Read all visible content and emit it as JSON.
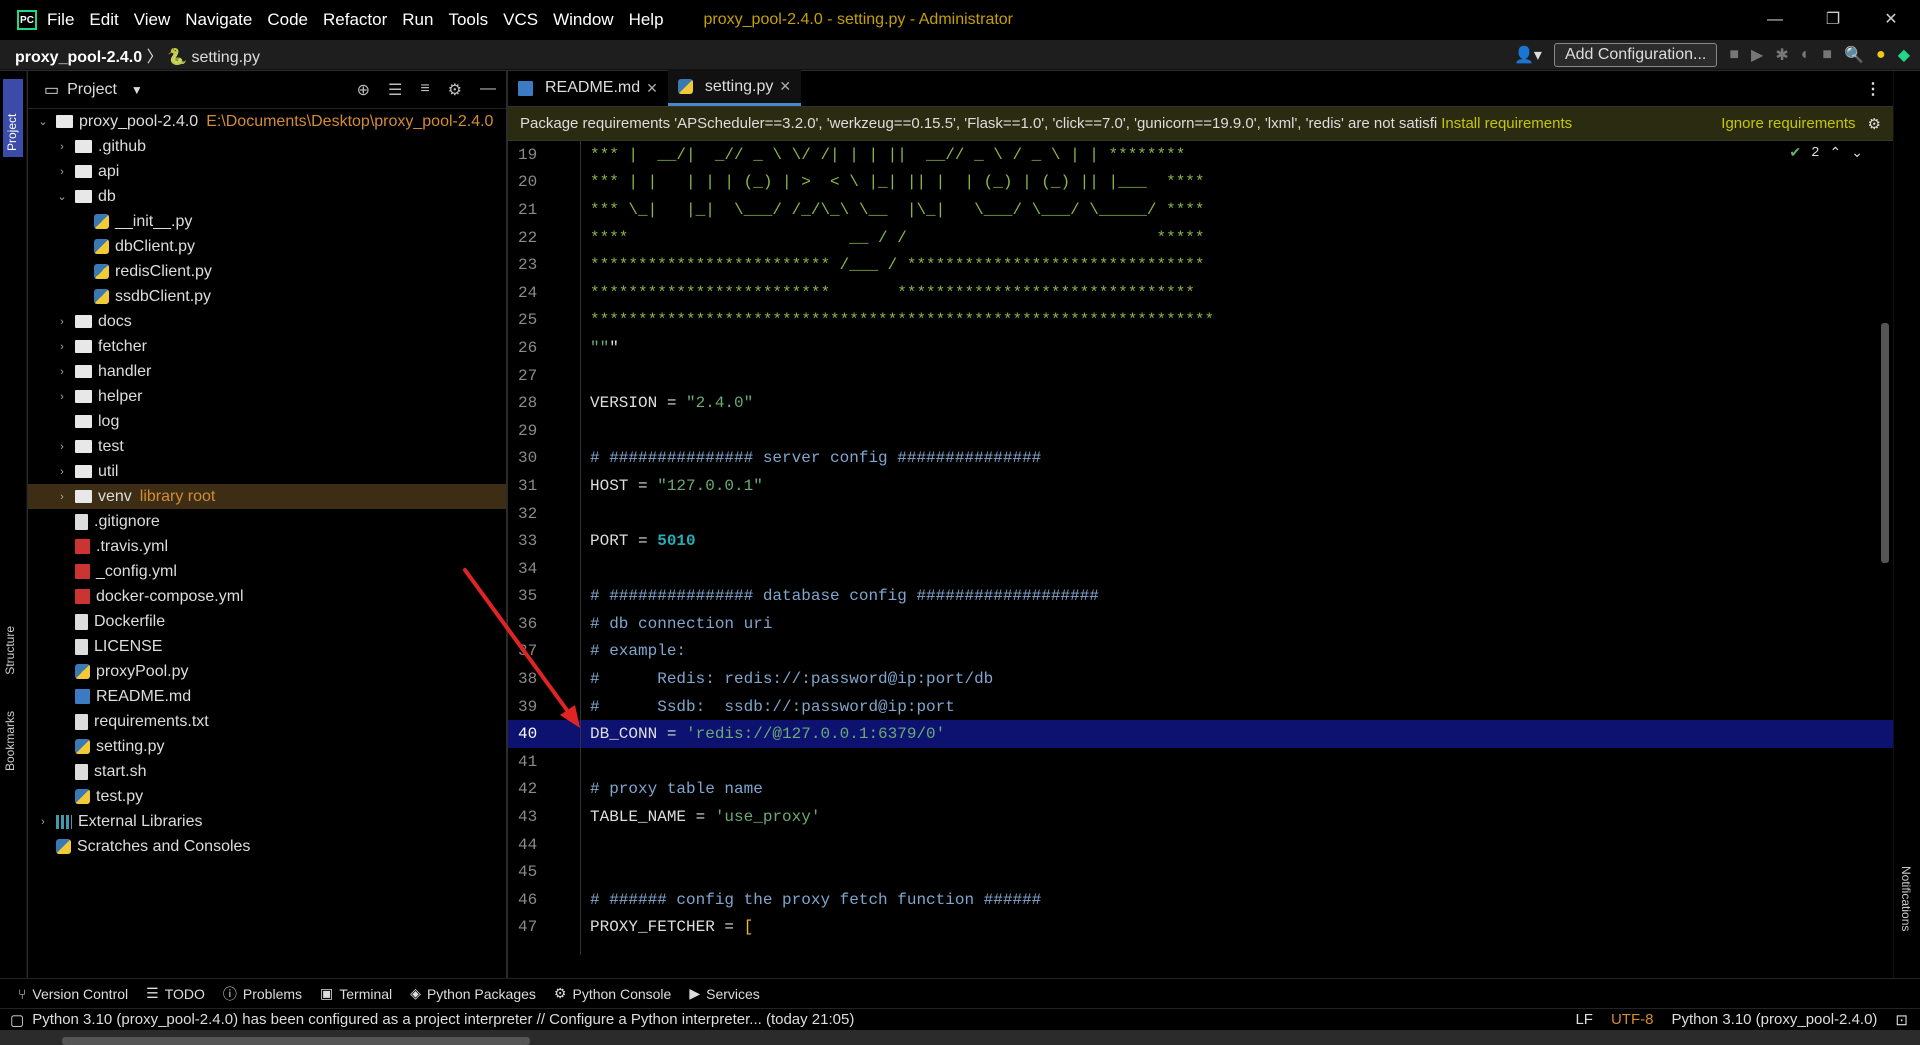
{
  "titlebar": {
    "menu": [
      "File",
      "Edit",
      "View",
      "Navigate",
      "Code",
      "Refactor",
      "Run",
      "Tools",
      "VCS",
      "Window",
      "Help"
    ],
    "title": "proxy_pool-2.4.0 - setting.py - Administrator"
  },
  "navbar": {
    "project": "proxy_pool-2.4.0",
    "file": "setting.py",
    "add_config": "Add Configuration..."
  },
  "left_tools": {
    "project": "Project",
    "structure": "Structure",
    "bookmarks": "Bookmarks"
  },
  "right_tools": {
    "notifications": "Notifications"
  },
  "project_panel": {
    "title": "Project",
    "root": {
      "name": "proxy_pool-2.4.0",
      "path": "E:\\Documents\\Desktop\\proxy_pool-2.4.0"
    },
    "items": [
      {
        "name": ".github"
      },
      {
        "name": "api"
      },
      {
        "name": "db"
      },
      {
        "name": "__init__.py"
      },
      {
        "name": "dbClient.py"
      },
      {
        "name": "redisClient.py"
      },
      {
        "name": "ssdbClient.py"
      },
      {
        "name": "docs"
      },
      {
        "name": "fetcher"
      },
      {
        "name": "handler"
      },
      {
        "name": "helper"
      },
      {
        "name": "log"
      },
      {
        "name": "test"
      },
      {
        "name": "util"
      },
      {
        "name": "venv",
        "note": "library root"
      },
      {
        "name": ".gitignore"
      },
      {
        "name": ".travis.yml"
      },
      {
        "name": "_config.yml"
      },
      {
        "name": "docker-compose.yml"
      },
      {
        "name": "Dockerfile"
      },
      {
        "name": "LICENSE"
      },
      {
        "name": "proxyPool.py"
      },
      {
        "name": "README.md"
      },
      {
        "name": "requirements.txt"
      },
      {
        "name": "setting.py"
      },
      {
        "name": "start.sh"
      },
      {
        "name": "test.py"
      }
    ],
    "external": "External Libraries",
    "scratches": "Scratches and Consoles"
  },
  "editor": {
    "tabs": [
      {
        "label": "README.md"
      },
      {
        "label": "setting.py"
      }
    ],
    "banner": {
      "text": "Package requirements 'APScheduler==3.2.0', 'werkzeug==0.15.5', 'Flask==1.0', 'click==7.0', 'gunicorn==19.9.0', 'lxml', 'redis' are not satisfi",
      "install": "Install requirements",
      "ignore": "Ignore requirements"
    },
    "inspections": "2",
    "lines": [
      {
        "n": "19",
        "t": "*** |  __/|  _// _ \\ \\/ /| | | ||  __// _ \\ / _ \\ | | ********"
      },
      {
        "n": "20",
        "t": "*** | |   | | | (_) | >  < \\ |_| || |  | (_) | (_) || |___  ****"
      },
      {
        "n": "21",
        "t": "*** \\_|   |_|  \\___/ /_/\\_\\ \\__  |\\_|   \\___/ \\___/ \\_____/ ****"
      },
      {
        "n": "22",
        "t": "****                       __ / /                          *****"
      },
      {
        "n": "23",
        "t": "************************* /___ / *******************************"
      },
      {
        "n": "24",
        "t": "*************************       *******************************"
      },
      {
        "n": "25",
        "t": "*****************************************************************"
      },
      {
        "n": "26",
        "t": "\"\"\""
      },
      {
        "n": "27",
        "t": ""
      },
      {
        "n": "28",
        "t": "VERSION = \"2.4.0\""
      },
      {
        "n": "29",
        "t": ""
      },
      {
        "n": "30",
        "t": "# ############### server config ###############"
      },
      {
        "n": "31",
        "t": "HOST = \"127.0.0.1\""
      },
      {
        "n": "32",
        "t": ""
      },
      {
        "n": "33",
        "t": "PORT = 5010"
      },
      {
        "n": "34",
        "t": ""
      },
      {
        "n": "35",
        "t": "# ############### database config ###################"
      },
      {
        "n": "36",
        "t": "# db connection uri"
      },
      {
        "n": "37",
        "t": "# example:"
      },
      {
        "n": "38",
        "t": "#      Redis: redis://:password@ip:port/db"
      },
      {
        "n": "39",
        "t": "#      Ssdb:  ssdb://:password@ip:port"
      },
      {
        "n": "40",
        "t": "DB_CONN = 'redis://@127.0.0.1:6379/0'"
      },
      {
        "n": "41",
        "t": ""
      },
      {
        "n": "42",
        "t": "# proxy table name"
      },
      {
        "n": "43",
        "t": "TABLE_NAME = 'use_proxy'"
      },
      {
        "n": "44",
        "t": ""
      },
      {
        "n": "45",
        "t": ""
      },
      {
        "n": "46",
        "t": "# ###### config the proxy fetch function ######"
      },
      {
        "n": "47",
        "t": "PROXY_FETCHER = ["
      }
    ]
  },
  "bottom_tabs": [
    "Version Control",
    "TODO",
    "Problems",
    "Terminal",
    "Python Packages",
    "Python Console",
    "Services"
  ],
  "status": {
    "message": "Python 3.10 (proxy_pool-2.4.0) has been configured as a project interpreter // Configure a Python interpreter... (today 21:05)",
    "line_sep": "LF",
    "encoding": "UTF-8",
    "interpreter": "Python 3.10 (proxy_pool-2.4.0)"
  },
  "colors": {
    "accent": "#4a88c7",
    "current_line": "#0d1170",
    "arrow": "#e02424",
    "banner_link": "#c4c60a"
  }
}
